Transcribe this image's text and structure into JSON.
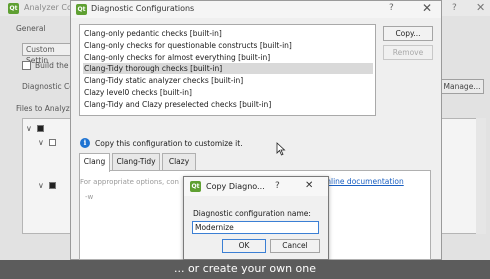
{
  "background_window": {
    "title": "Analyzer Co",
    "help": "?",
    "close": "✕",
    "general_label": "General",
    "combo_value": "Custom Settin",
    "build_label": "Build the p",
    "diag_cfg_label": "Diagnostic Co",
    "manage_button": "Manage...",
    "files_label": "Files to Analyz"
  },
  "dialog": {
    "title": "Diagnostic Configurations",
    "help": "?",
    "close": "✕",
    "configs": [
      "Clang-only pedantic checks [built-in]",
      "Clang-only checks for questionable constructs [built-in]",
      "Clang-only checks for almost everything [built-in]",
      "Clang-Tidy thorough checks [built-in]",
      "Clang-Tidy static analyzer checks [built-in]",
      "Clazy level0 checks [built-in]",
      "Clang-Tidy and Clazy preselected checks [built-in]"
    ],
    "copy_button": "Copy...",
    "remove_button": "Remove",
    "info_text": "Copy this configuration to customize it.",
    "tabs": [
      "Clang",
      "Clang-Tidy",
      "Clazy"
    ],
    "options_hint": "For appropriate options, con",
    "flag_text": "-w",
    "gcc_link": "GCC online documentation"
  },
  "copy_dialog": {
    "title": "Copy Diagno...",
    "help": "?",
    "close": "✕",
    "name_label": "Diagnostic configuration name:",
    "name_value": "Modernize",
    "ok_button": "OK",
    "cancel_button": "Cancel"
  },
  "caption": "... or create your own one",
  "colors": {
    "accent": "#3b7fd4",
    "info_blue": "#1e73d2",
    "qt_green": "#5fa032",
    "link": "#1a5fc1"
  },
  "icons": {
    "app_logo": "qt-logo-icon",
    "info": "info-icon",
    "cursor": "mouse-cursor-icon"
  }
}
